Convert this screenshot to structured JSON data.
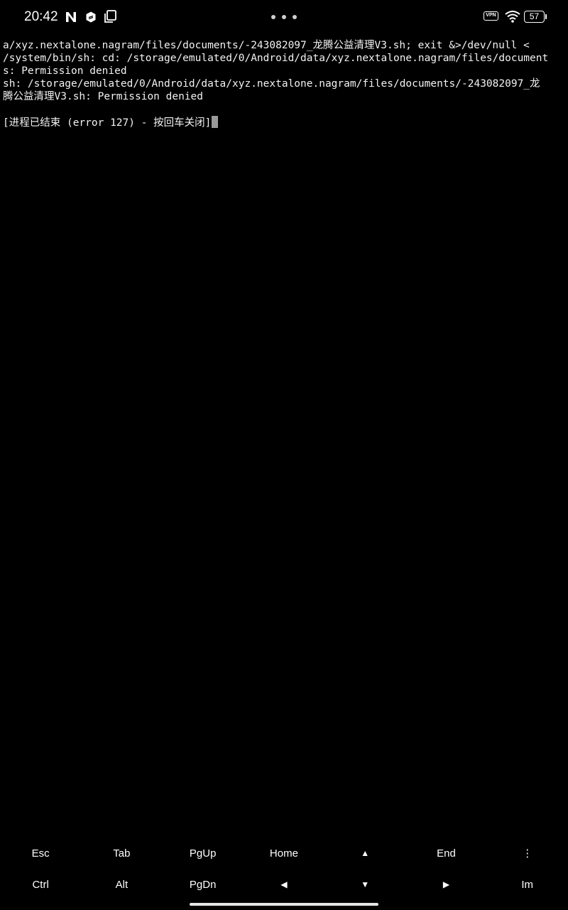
{
  "status_bar": {
    "time": "20:42",
    "notification_icons": [
      "n-app-icon",
      "hexagon-app-icon",
      "copy-icon"
    ],
    "vpn_label": "VPN",
    "battery_level": "57",
    "icons": [
      "wifi-icon",
      "battery-icon",
      "more-dots-icon"
    ]
  },
  "terminal": {
    "lines": [
      "a/xyz.nextalone.nagram/files/documents/-243082097_龙腾公益清理V3.sh; exit &>/dev/null <",
      "/system/bin/sh: cd: /storage/emulated/0/Android/data/xyz.nextalone.nagram/files/document",
      "s: Permission denied",
      "sh: /storage/emulated/0/Android/data/xyz.nextalone.nagram/files/documents/-243082097_龙",
      "腾公益清理V3.sh: Permission denied",
      ""
    ],
    "prompt_line": "[进程已结束 (error 127) - 按回车关闭]"
  },
  "extra_keys": {
    "row1": [
      "Esc",
      "Tab",
      "PgUp",
      "Home",
      "▲",
      "End",
      "⋮"
    ],
    "row2": [
      "Ctrl",
      "Alt",
      "PgDn",
      "◀",
      "▼",
      "▶",
      "Im"
    ]
  },
  "colors": {
    "background": "#000000",
    "text": "#f2f2f2",
    "cursor": "#9a9a9a"
  }
}
